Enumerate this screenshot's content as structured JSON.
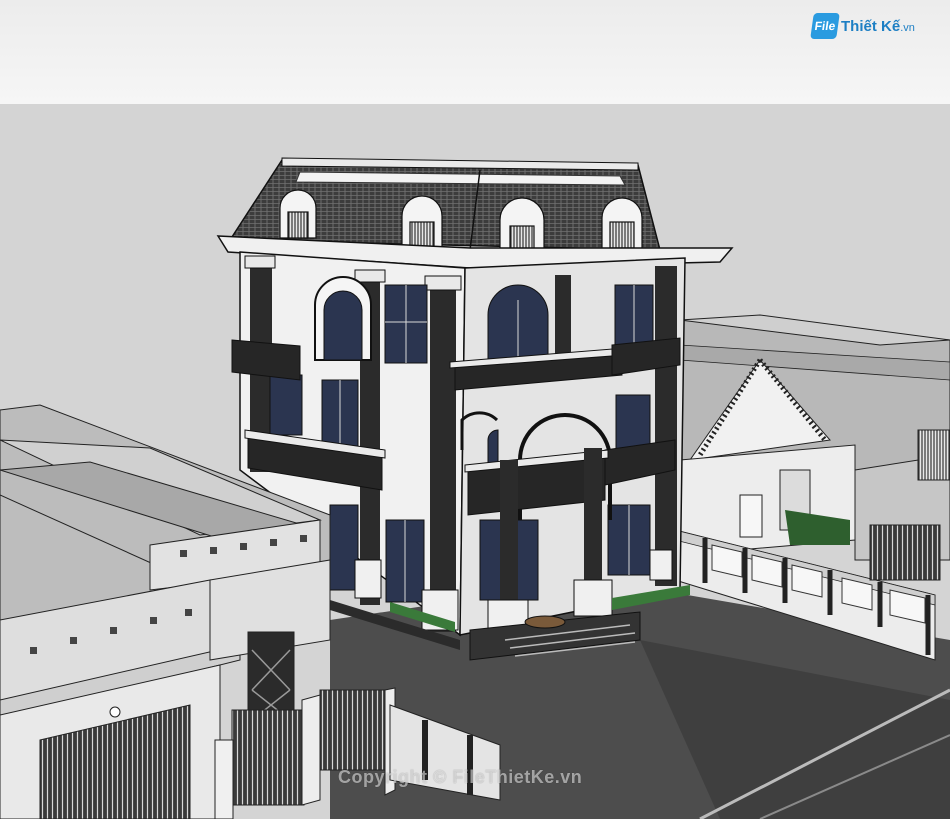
{
  "logo": {
    "badge": "File",
    "text": "Thiết Kế",
    "suffix": ".vn"
  },
  "watermark": {
    "text": "Copyright © FileThietKe.vn"
  },
  "colors": {
    "sky": "#d4d4d4",
    "ground": "#4a4a4a",
    "wall_white": "#f2f2f2",
    "roof_dark": "#2b2b2b",
    "window_blue": "#2b3550",
    "neighbor_gray": "#bdbdbd",
    "logo_blue": "#1d7fc4"
  }
}
